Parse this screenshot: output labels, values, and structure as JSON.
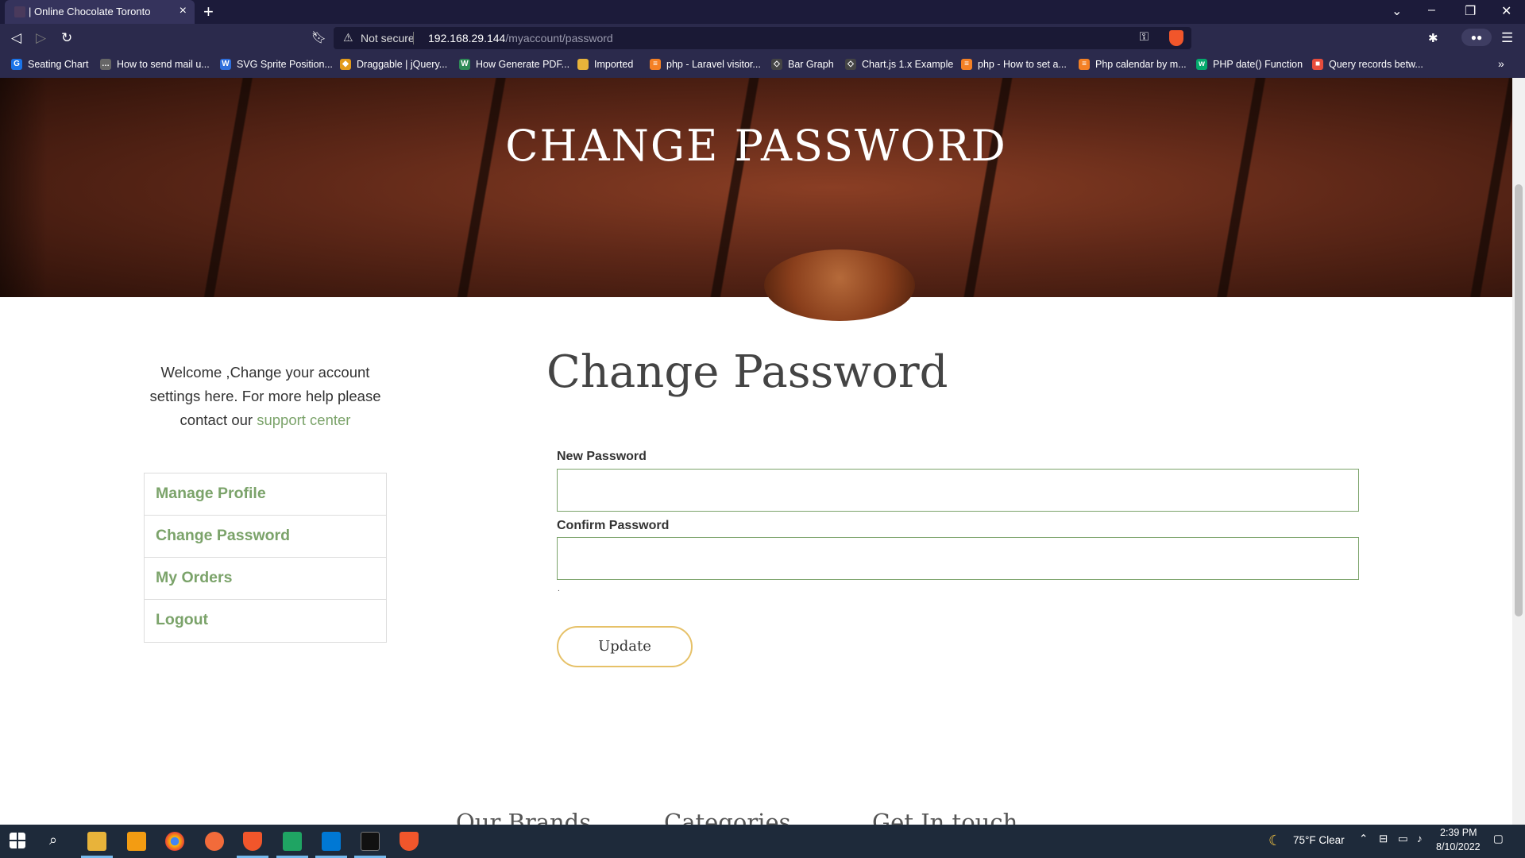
{
  "browser": {
    "tab_title": "| Online Chocolate Toronto",
    "tab_close": "×",
    "new_tab": "+",
    "url_warning": "Not secure",
    "url_host": "192.168.29.144",
    "url_path": "/myaccount/password",
    "bookmarks": [
      {
        "label": "Seating Chart",
        "icon": "go-icon",
        "color": "#1a73e8"
      },
      {
        "label": "How to send mail u...",
        "icon": "chat-icon",
        "color": "#666666"
      },
      {
        "label": "SVG Sprite Position...",
        "icon": "w-icon",
        "color": "#2f6fdc"
      },
      {
        "label": "Draggable | jQuery...",
        "icon": "shield-icon",
        "color": "#e39b1a"
      },
      {
        "label": "How Generate PDF...",
        "icon": "w-icon",
        "color": "#2e8b57"
      },
      {
        "label": "Imported",
        "icon": "folder-icon",
        "color": "#e8b33a"
      },
      {
        "label": "php - Laravel visitor...",
        "icon": "stack-icon",
        "color": "#f48024"
      },
      {
        "label": "Bar Graph",
        "icon": "codepen-icon",
        "color": "#444444"
      },
      {
        "label": "Chart.js 1.x Example",
        "icon": "codepen-icon",
        "color": "#444444"
      },
      {
        "label": "php - How to set a...",
        "icon": "stack-icon",
        "color": "#f48024"
      },
      {
        "label": "Php calendar by m...",
        "icon": "stack-icon",
        "color": "#f48024"
      },
      {
        "label": "PHP date() Function",
        "icon": "w3-icon",
        "color": "#04aa6d"
      },
      {
        "label": "Query records betw...",
        "icon": "windows-icon",
        "color": "#e74c3c"
      }
    ]
  },
  "hero": {
    "title": "CHANGE PASSWORD"
  },
  "sidebar": {
    "intro_text": "Welcome ,Change your account settings here. For more help please contact our ",
    "support_link": "support center",
    "items": [
      {
        "label": "Manage Profile"
      },
      {
        "label": "Change Password"
      },
      {
        "label": "My Orders"
      },
      {
        "label": "Logout"
      }
    ]
  },
  "main": {
    "title": "Change Password",
    "new_password_label": "New Password",
    "new_password_value": "",
    "confirm_password_label": "Confirm Password",
    "confirm_password_value": "",
    "note": ".",
    "update_label": "Update"
  },
  "footer": {
    "headings": [
      "Our Brands",
      "Categories",
      "Get In touch"
    ]
  },
  "taskbar": {
    "weather": "75°F  Clear",
    "time": "2:39 PM",
    "date": "8/10/2022"
  },
  "colors": {
    "accent_green": "#7ba36a",
    "button_border": "#e6c168",
    "chrome_bg": "#2b2a4c"
  }
}
